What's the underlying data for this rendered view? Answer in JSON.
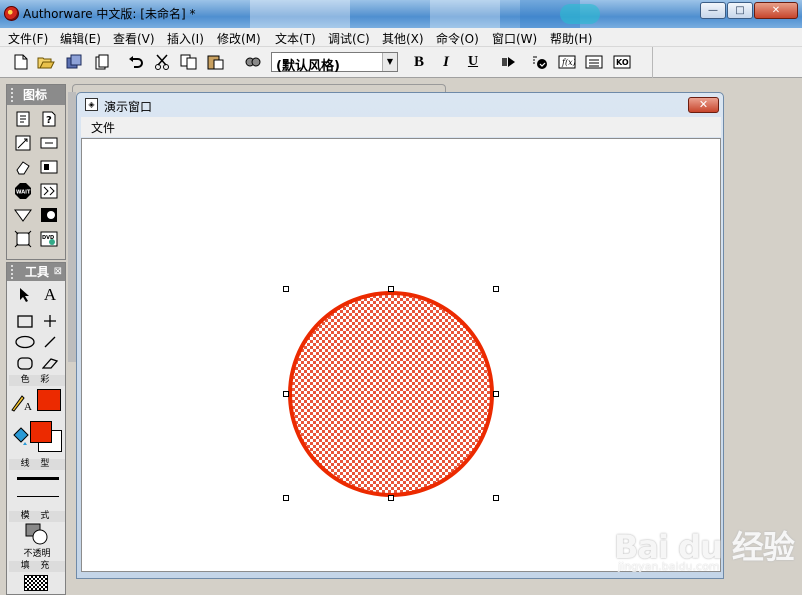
{
  "app": {
    "title": "Authorware 中文版: [未命名] *",
    "window_buttons": {
      "minimize": "—",
      "maximize": "□",
      "close": "✕"
    }
  },
  "menu": {
    "items": [
      "文件(F)",
      "编辑(E)",
      "查看(V)",
      "插入(I)",
      "修改(M)",
      "文本(T)",
      "调试(C)",
      "其他(X)",
      "命令(O)",
      "窗口(W)",
      "帮助(H)"
    ]
  },
  "toolbar": {
    "style_value": "(默认风格)",
    "bold": "B",
    "italic": "I",
    "underline": "U"
  },
  "icons_panel": {
    "title": "图标"
  },
  "tools_panel": {
    "title": "工具",
    "close": "⊠",
    "color_label": "色 彩",
    "line_label": "线 型",
    "mode_label": "模 式",
    "mode_value": "不透明",
    "fill_label": "填 充",
    "fill_color": "#ec2a00",
    "stroke_color": "#ec2a00"
  },
  "presentation_window": {
    "title": "演示窗口",
    "menu_file": "文件",
    "close": "✕",
    "circle": {
      "stroke_color": "#ec2a00",
      "fill_pattern": "checker",
      "fill_color": "#e8553a",
      "selected": true
    }
  },
  "watermark": {
    "logo": "Bai du 经验",
    "url": "jingyan.baidu.com"
  }
}
